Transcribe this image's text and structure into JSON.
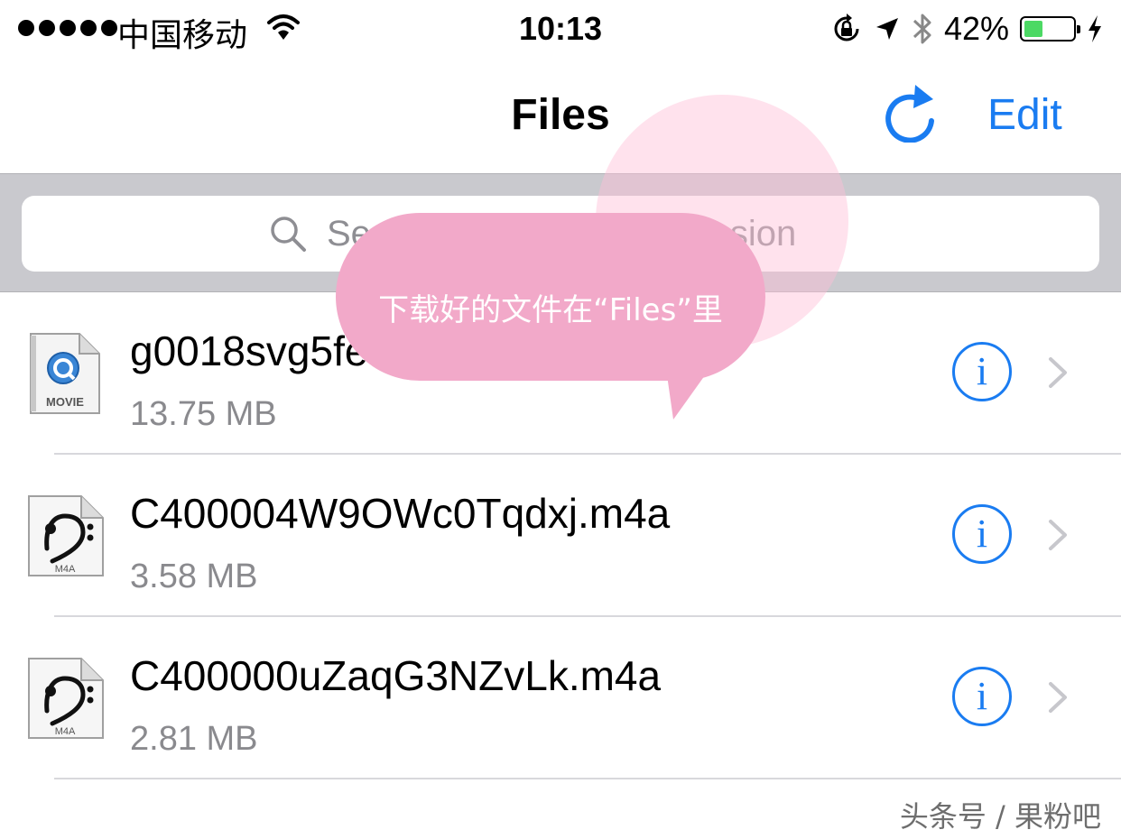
{
  "status_bar": {
    "carrier": "中国移动",
    "time": "10:13",
    "battery_percent": "42%",
    "battery_level": 0.42,
    "icons": [
      "signal-dots-icon",
      "wifi-icon",
      "rotation-lock-icon",
      "location-arrow-icon",
      "bluetooth-icon",
      "battery-icon",
      "charging-bolt-icon"
    ]
  },
  "nav": {
    "title": "Files",
    "refresh_icon": "refresh-icon",
    "edit_label": "Edit"
  },
  "search": {
    "placeholder": "Search by name or extension",
    "value": ""
  },
  "files": [
    {
      "name": "g0018svg5fe",
      "size": "13.75 MB",
      "icon": "movie-file-icon",
      "icon_label": "MOVIE"
    },
    {
      "name": "C400004W9OWc0Tqdxj.m4a",
      "size": "3.58 MB",
      "icon": "audio-file-icon",
      "icon_label": "M4A"
    },
    {
      "name": "C400000uZaqG3NZvLk.m4a",
      "size": "2.81 MB",
      "icon": "audio-file-icon",
      "icon_label": "M4A"
    }
  ],
  "row_actions": {
    "info_icon": "i"
  },
  "overlay": {
    "bubble_text": "下载好的文件在“Files”里",
    "watermark": "头条号 / 果粉吧"
  },
  "colors": {
    "accent": "#1a7cf1",
    "search_bar_bg": "#c9c9ce",
    "bubble": "#f2a9c9",
    "battery_fill": "#4cd964"
  }
}
